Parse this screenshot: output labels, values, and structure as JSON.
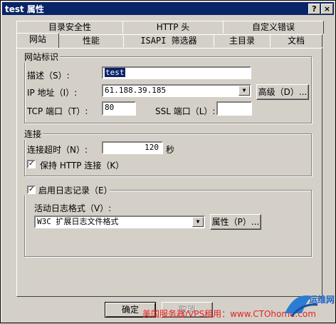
{
  "window": {
    "title": "test 属性",
    "help_glyph": "?",
    "close_glyph": "×"
  },
  "tabs": {
    "back": [
      "目录安全性",
      "HTTP 头",
      "自定义错误"
    ],
    "front": [
      "网站",
      "性能",
      "ISAPI 筛选器",
      "主目录",
      "文档"
    ],
    "active": "网站"
  },
  "site_id": {
    "title": "网站标识",
    "desc_label": "描述（S）:",
    "desc_value": "test",
    "ip_label": "IP 地址（I）:",
    "ip_value": "61.188.39.185",
    "advanced_button": "高级（D）...",
    "tcp_label": "TCP 端口（T）:",
    "tcp_value": "80",
    "ssl_label": "SSL 端口（L）:",
    "ssl_value": ""
  },
  "connection": {
    "title": "连接",
    "timeout_label": "连接超时（N）:",
    "timeout_value": "120",
    "timeout_unit": "秒",
    "keepalive_label": "保持 HTTP 连接（K）",
    "keepalive_checked": true
  },
  "logging": {
    "enable_label": "启用日志记录（E）",
    "enable_checked": true,
    "format_label": "活动日志格式（V）:",
    "format_value": "W3C 扩展日志文件格式",
    "properties_button": "属性（P）..."
  },
  "footer": {
    "ok": "确定",
    "cancel": "取消"
  },
  "overlay": {
    "watermark": "美国服务器/VPS租用：www.CTOhome.com",
    "logo": "运维网"
  },
  "icons": {
    "dropdown": "triangle-down",
    "check": "checkmark"
  }
}
